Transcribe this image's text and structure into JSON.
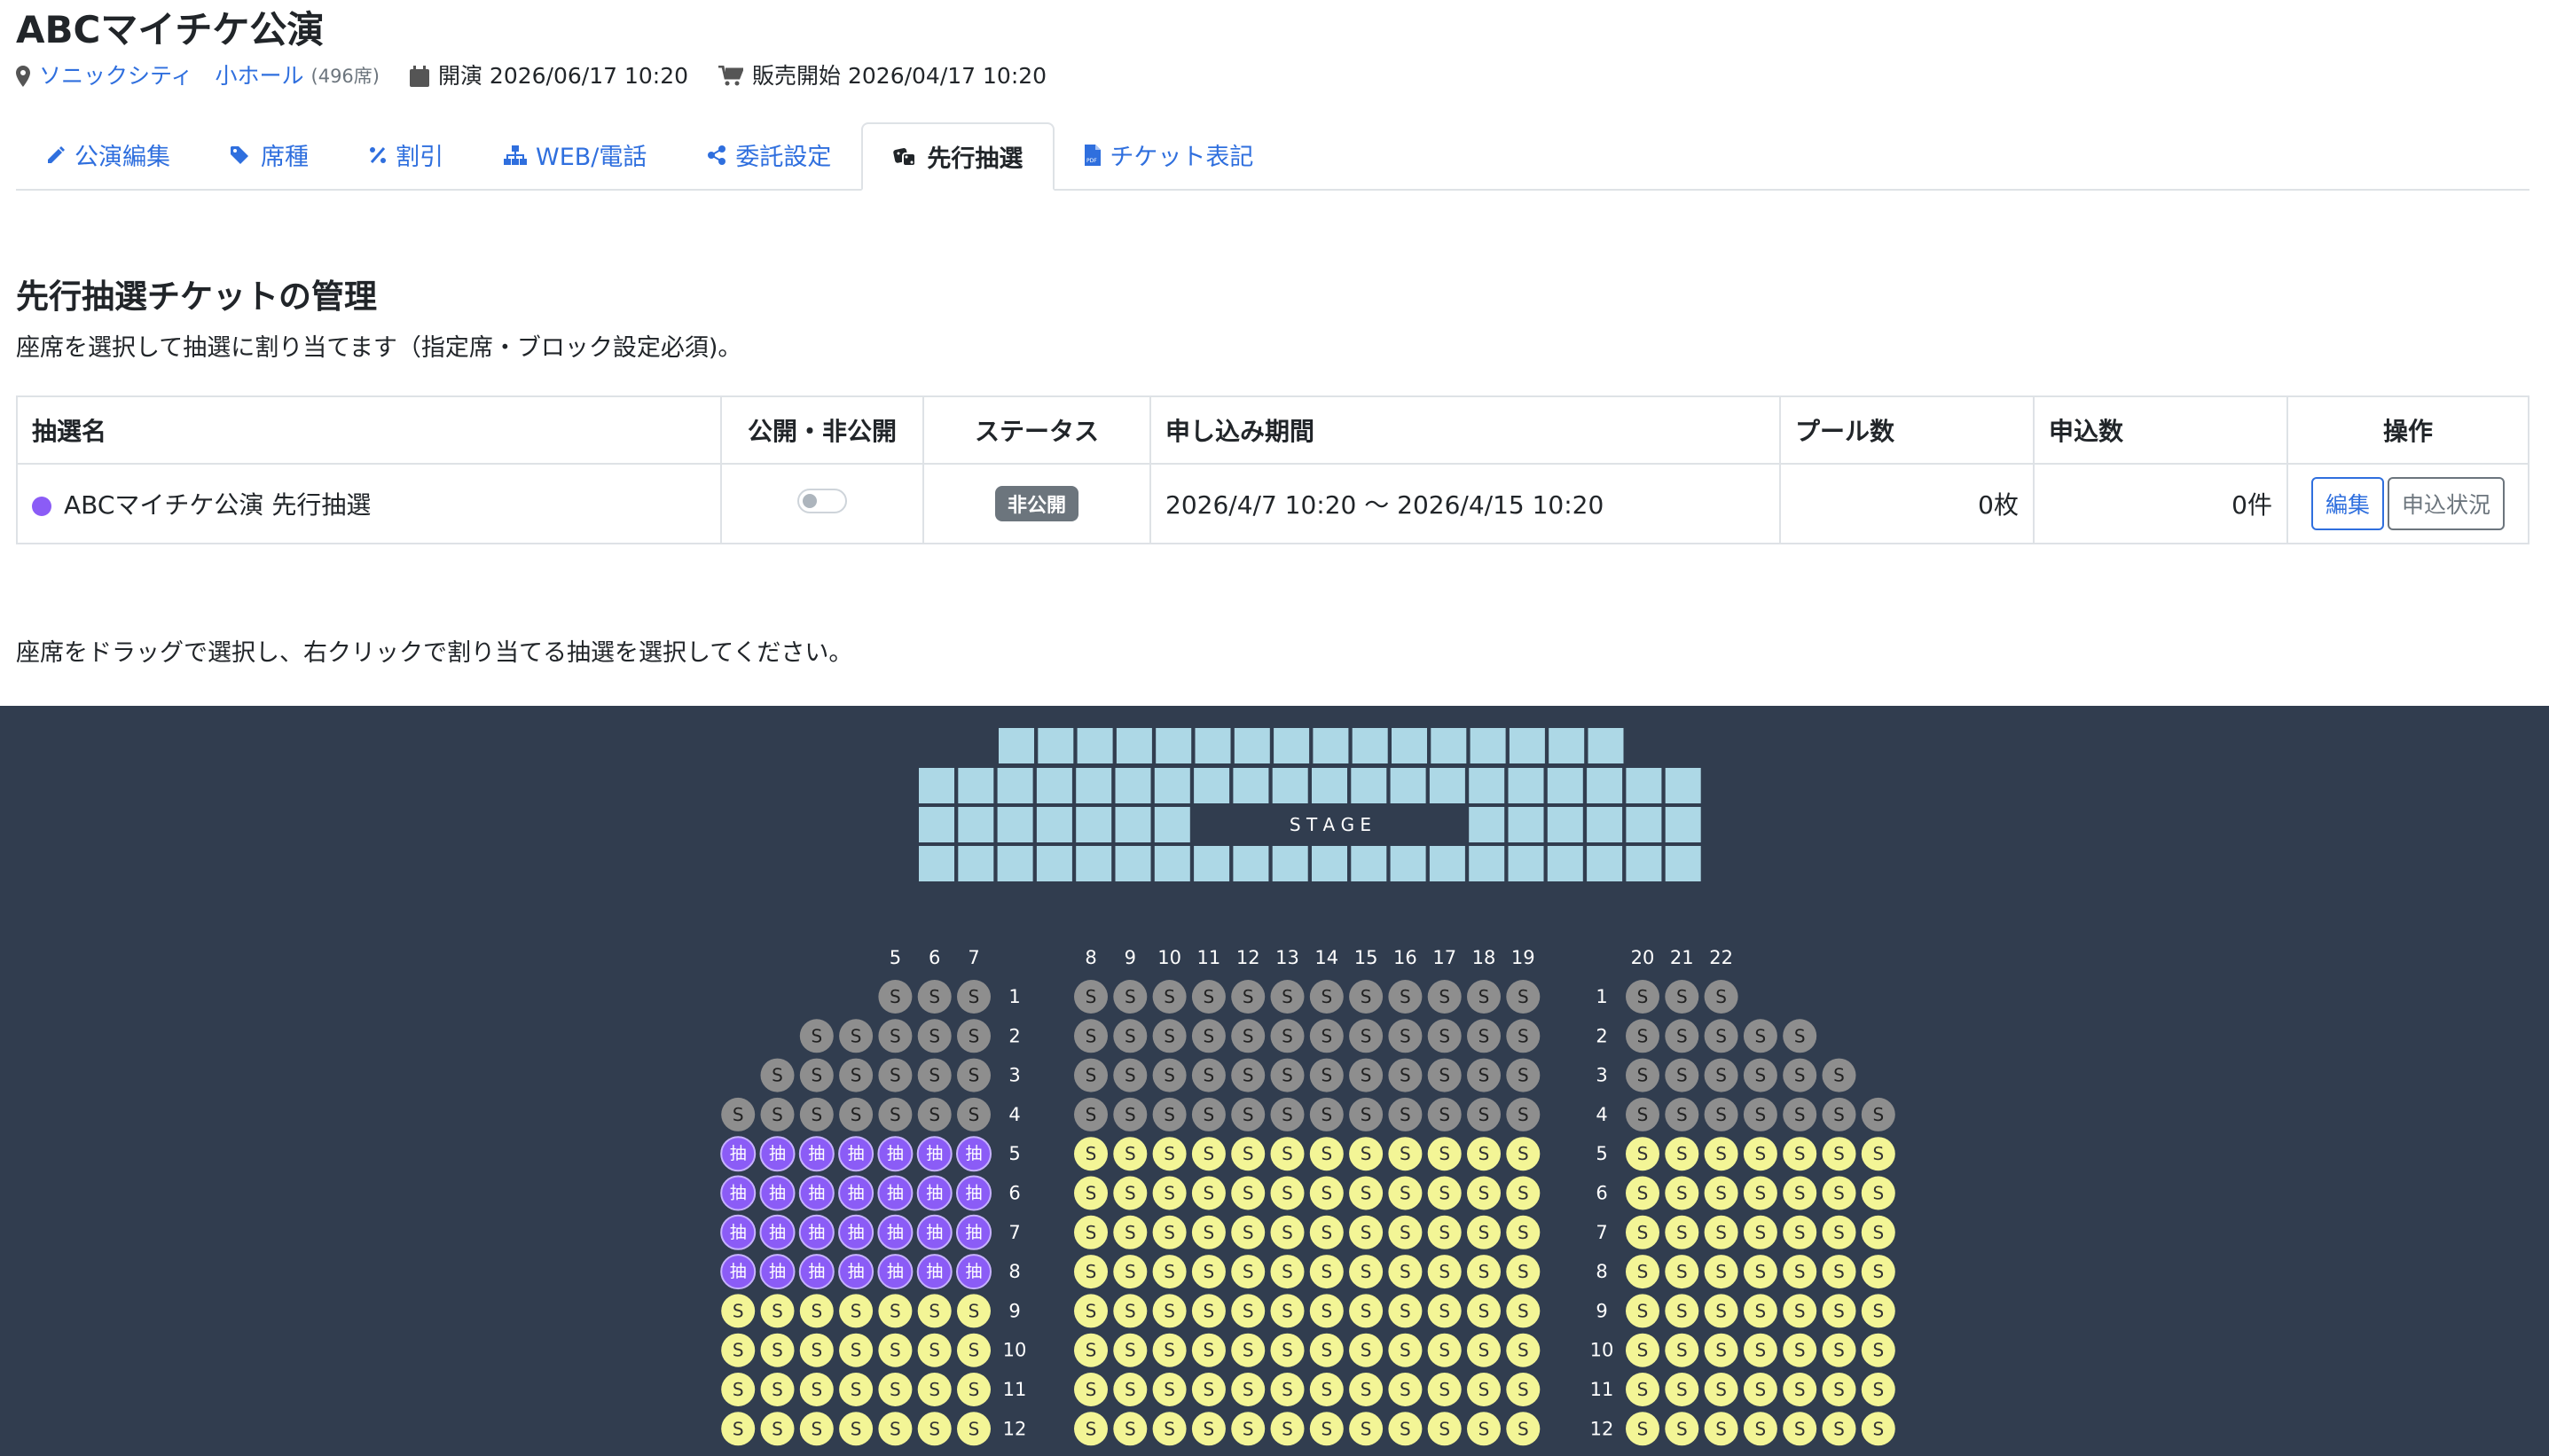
{
  "header": {
    "title": "ABCマイチケ公演",
    "venue_link": "ソニックシティ　小ホール",
    "venue_seats": "(496席)",
    "open_label": "開演 2026/06/17 10:20",
    "sale_label": "販売開始 2026/04/17 10:20"
  },
  "tabs": [
    {
      "label": "公演編集",
      "icon": "pencil-icon"
    },
    {
      "label": "席種",
      "icon": "tags-icon"
    },
    {
      "label": "割引",
      "icon": "percent-icon"
    },
    {
      "label": "WEB/電話",
      "icon": "sitemap-icon"
    },
    {
      "label": "委託設定",
      "icon": "share-icon"
    },
    {
      "label": "先行抽選",
      "icon": "dice-icon",
      "active": true
    },
    {
      "label": "チケット表記",
      "icon": "file-pdf-icon"
    }
  ],
  "section": {
    "heading": "先行抽選チケットの管理",
    "description": "座席を選択して抽選に割り当てます（指定席・ブロック設定必須)。"
  },
  "table": {
    "headers": [
      "抽選名",
      "公開・非公開",
      "ステータス",
      "申し込み期間",
      "プール数",
      "申込数",
      "操作"
    ],
    "rows": [
      {
        "name": "ABCマイチケ公演 先行抽選",
        "color": "#8b5cf6",
        "public": false,
        "status": "非公開",
        "period": "2026/4/7 10:20 〜 2026/4/15 10:20",
        "pool": "0枚",
        "applications": "0件",
        "edit_label": "編集",
        "status_label": "申込状況"
      }
    ]
  },
  "hint": "座席をドラッグで選択し、右クリックで割り当てる抽選を選択してください。",
  "seatmap": {
    "stage_label": "S T A G E",
    "column_labels_left": [
      "5",
      "6",
      "7"
    ],
    "column_labels_center": [
      "8",
      "9",
      "10",
      "11",
      "12",
      "13",
      "14",
      "15",
      "16",
      "17",
      "18",
      "19"
    ],
    "column_labels_right": [
      "20",
      "21",
      "22"
    ],
    "row_labels": [
      "1",
      "2",
      "3",
      "4",
      "5",
      "6",
      "7",
      "8",
      "9",
      "10",
      "11",
      "12"
    ],
    "left_block_counts": [
      3,
      5,
      6,
      7,
      7,
      7,
      7,
      7,
      7,
      7,
      7,
      7
    ],
    "right_block_counts": [
      3,
      5,
      6,
      7,
      7,
      7,
      7,
      7,
      7,
      7,
      7,
      7
    ],
    "center_block_count": 12,
    "seat_text": "S",
    "lottery_text": "抽",
    "lottery_rows_left": [
      "5",
      "6",
      "7",
      "8"
    ],
    "sold_rows": [
      "1",
      "2",
      "3",
      "4"
    ],
    "colors": {
      "background": "#313d4f",
      "stage": "#add8e6",
      "sold": "#8e8e8e",
      "available": "#f3f596",
      "lottery": "#8b5cf6",
      "lottery_border": "#c7b2ff"
    }
  }
}
